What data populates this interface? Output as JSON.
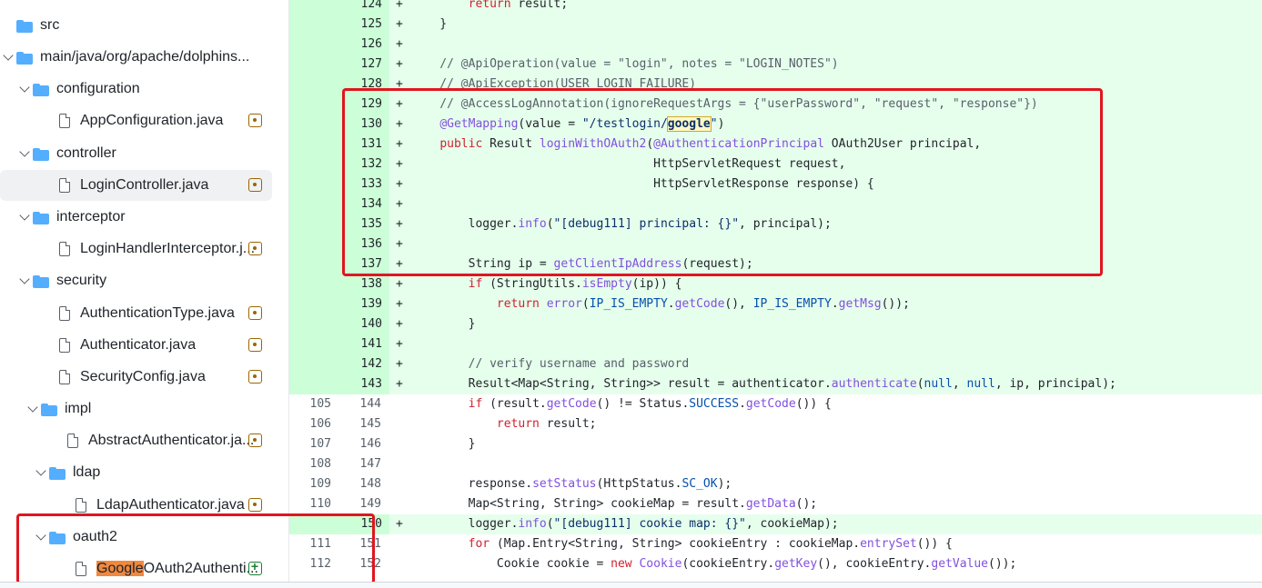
{
  "file_tree": [
    {
      "label": "src",
      "type": "folder",
      "indent": 0,
      "expanded": true
    },
    {
      "label": "main/java/org/apache/dolphins...",
      "type": "folder",
      "indent": 0,
      "expanded": true,
      "chevron": true
    },
    {
      "label": "configuration",
      "type": "folder",
      "indent": 1,
      "expanded": true
    },
    {
      "label": "AppConfiguration.java",
      "type": "file",
      "indent": 1,
      "status": "modified"
    },
    {
      "label": "controller",
      "type": "folder",
      "indent": 1,
      "expanded": true
    },
    {
      "label": "LoginController.java",
      "type": "file",
      "indent": 1,
      "status": "modified",
      "selected": true
    },
    {
      "label": "interceptor",
      "type": "folder",
      "indent": 1,
      "expanded": true
    },
    {
      "label": "LoginHandlerInterceptor.j...",
      "type": "file",
      "indent": 1,
      "status": "modified"
    },
    {
      "label": "security",
      "type": "folder",
      "indent": 1,
      "expanded": true
    },
    {
      "label": "AuthenticationType.java",
      "type": "file",
      "indent": 1,
      "status": "modified"
    },
    {
      "label": "Authenticator.java",
      "type": "file",
      "indent": 1,
      "status": "modified"
    },
    {
      "label": "SecurityConfig.java",
      "type": "file",
      "indent": 1,
      "status": "modified"
    },
    {
      "label": "impl",
      "type": "folder",
      "indent": 2,
      "expanded": true
    },
    {
      "label": "AbstractAuthenticator.ja...",
      "type": "file",
      "indent": 2,
      "status": "modified"
    },
    {
      "label": "ldap",
      "type": "folder",
      "indent": 3,
      "expanded": true
    },
    {
      "label": "LdapAuthenticator.java",
      "type": "file",
      "indent": 3,
      "status": "modified"
    },
    {
      "label": "oauth2",
      "type": "folder",
      "indent": 3,
      "expanded": true
    },
    {
      "label": "GoogleOAuth2Authenti...",
      "highlight": "Google",
      "rest": "OAuth2Authenti...",
      "type": "file",
      "indent": 3,
      "status": "added"
    }
  ],
  "diff_lines": [
    {
      "old": "",
      "new": "124",
      "add": true,
      "code": "        return result;"
    },
    {
      "old": "",
      "new": "125",
      "add": true,
      "code": "    }"
    },
    {
      "old": "",
      "new": "126",
      "add": true,
      "code": ""
    },
    {
      "old": "",
      "new": "127",
      "add": true,
      "code": "    // @ApiOperation(value = \"login\", notes = \"LOGIN_NOTES\")"
    },
    {
      "old": "",
      "new": "128",
      "add": true,
      "code": "    // @ApiException(USER_LOGIN_FAILURE)"
    },
    {
      "old": "",
      "new": "129",
      "add": true,
      "code": "    // @AccessLogAnnotation(ignoreRequestArgs = {\"userPassword\", \"request\", \"response\"})"
    },
    {
      "old": "",
      "new": "130",
      "add": true,
      "code": "    @GetMapping(value = \"/testlogin/google\")"
    },
    {
      "old": "",
      "new": "131",
      "add": true,
      "code": "    public Result loginWithOAuth2(@AuthenticationPrincipal OAuth2User principal,"
    },
    {
      "old": "",
      "new": "132",
      "add": true,
      "code": "                                  HttpServletRequest request,"
    },
    {
      "old": "",
      "new": "133",
      "add": true,
      "code": "                                  HttpServletResponse response) {"
    },
    {
      "old": "",
      "new": "134",
      "add": true,
      "code": ""
    },
    {
      "old": "",
      "new": "135",
      "add": true,
      "code": "        logger.info(\"[debug111] principal: {}\", principal);"
    },
    {
      "old": "",
      "new": "136",
      "add": true,
      "code": ""
    },
    {
      "old": "",
      "new": "137",
      "add": true,
      "code": "        String ip = getClientIpAddress(request);"
    },
    {
      "old": "",
      "new": "138",
      "add": true,
      "code": "        if (StringUtils.isEmpty(ip)) {"
    },
    {
      "old": "",
      "new": "139",
      "add": true,
      "code": "            return error(IP_IS_EMPTY.getCode(), IP_IS_EMPTY.getMsg());"
    },
    {
      "old": "",
      "new": "140",
      "add": true,
      "code": "        }"
    },
    {
      "old": "",
      "new": "141",
      "add": true,
      "code": ""
    },
    {
      "old": "",
      "new": "142",
      "add": true,
      "code": "        // verify username and password"
    },
    {
      "old": "",
      "new": "143",
      "add": true,
      "code": "        Result<Map<String, String>> result = authenticator.authenticate(null, null, ip, principal);"
    },
    {
      "old": "105",
      "new": "144",
      "add": false,
      "code": "        if (result.getCode() != Status.SUCCESS.getCode()) {"
    },
    {
      "old": "106",
      "new": "145",
      "add": false,
      "code": "            return result;"
    },
    {
      "old": "107",
      "new": "146",
      "add": false,
      "code": "        }"
    },
    {
      "old": "108",
      "new": "147",
      "add": false,
      "code": ""
    },
    {
      "old": "109",
      "new": "148",
      "add": false,
      "code": "        response.setStatus(HttpStatus.SC_OK);"
    },
    {
      "old": "110",
      "new": "149",
      "add": false,
      "code": "        Map<String, String> cookieMap = result.getData();"
    },
    {
      "old": "",
      "new": "150",
      "add": true,
      "code": "        logger.info(\"[debug111] cookie map: {}\", cookieMap);"
    },
    {
      "old": "111",
      "new": "151",
      "add": false,
      "code": "        for (Map.Entry<String, String> cookieEntry : cookieMap.entrySet()) {"
    },
    {
      "old": "112",
      "new": "152",
      "add": false,
      "code": "            Cookie cookie = new Cookie(cookieEntry.getKey(), cookieEntry.getValue());"
    }
  ],
  "markers": {
    "add": "+"
  },
  "colors": {
    "added_bg": "#e6ffec",
    "added_gutter": "#ccffd8",
    "annotation_box": "#e0161f",
    "folder": "#54aeff"
  }
}
